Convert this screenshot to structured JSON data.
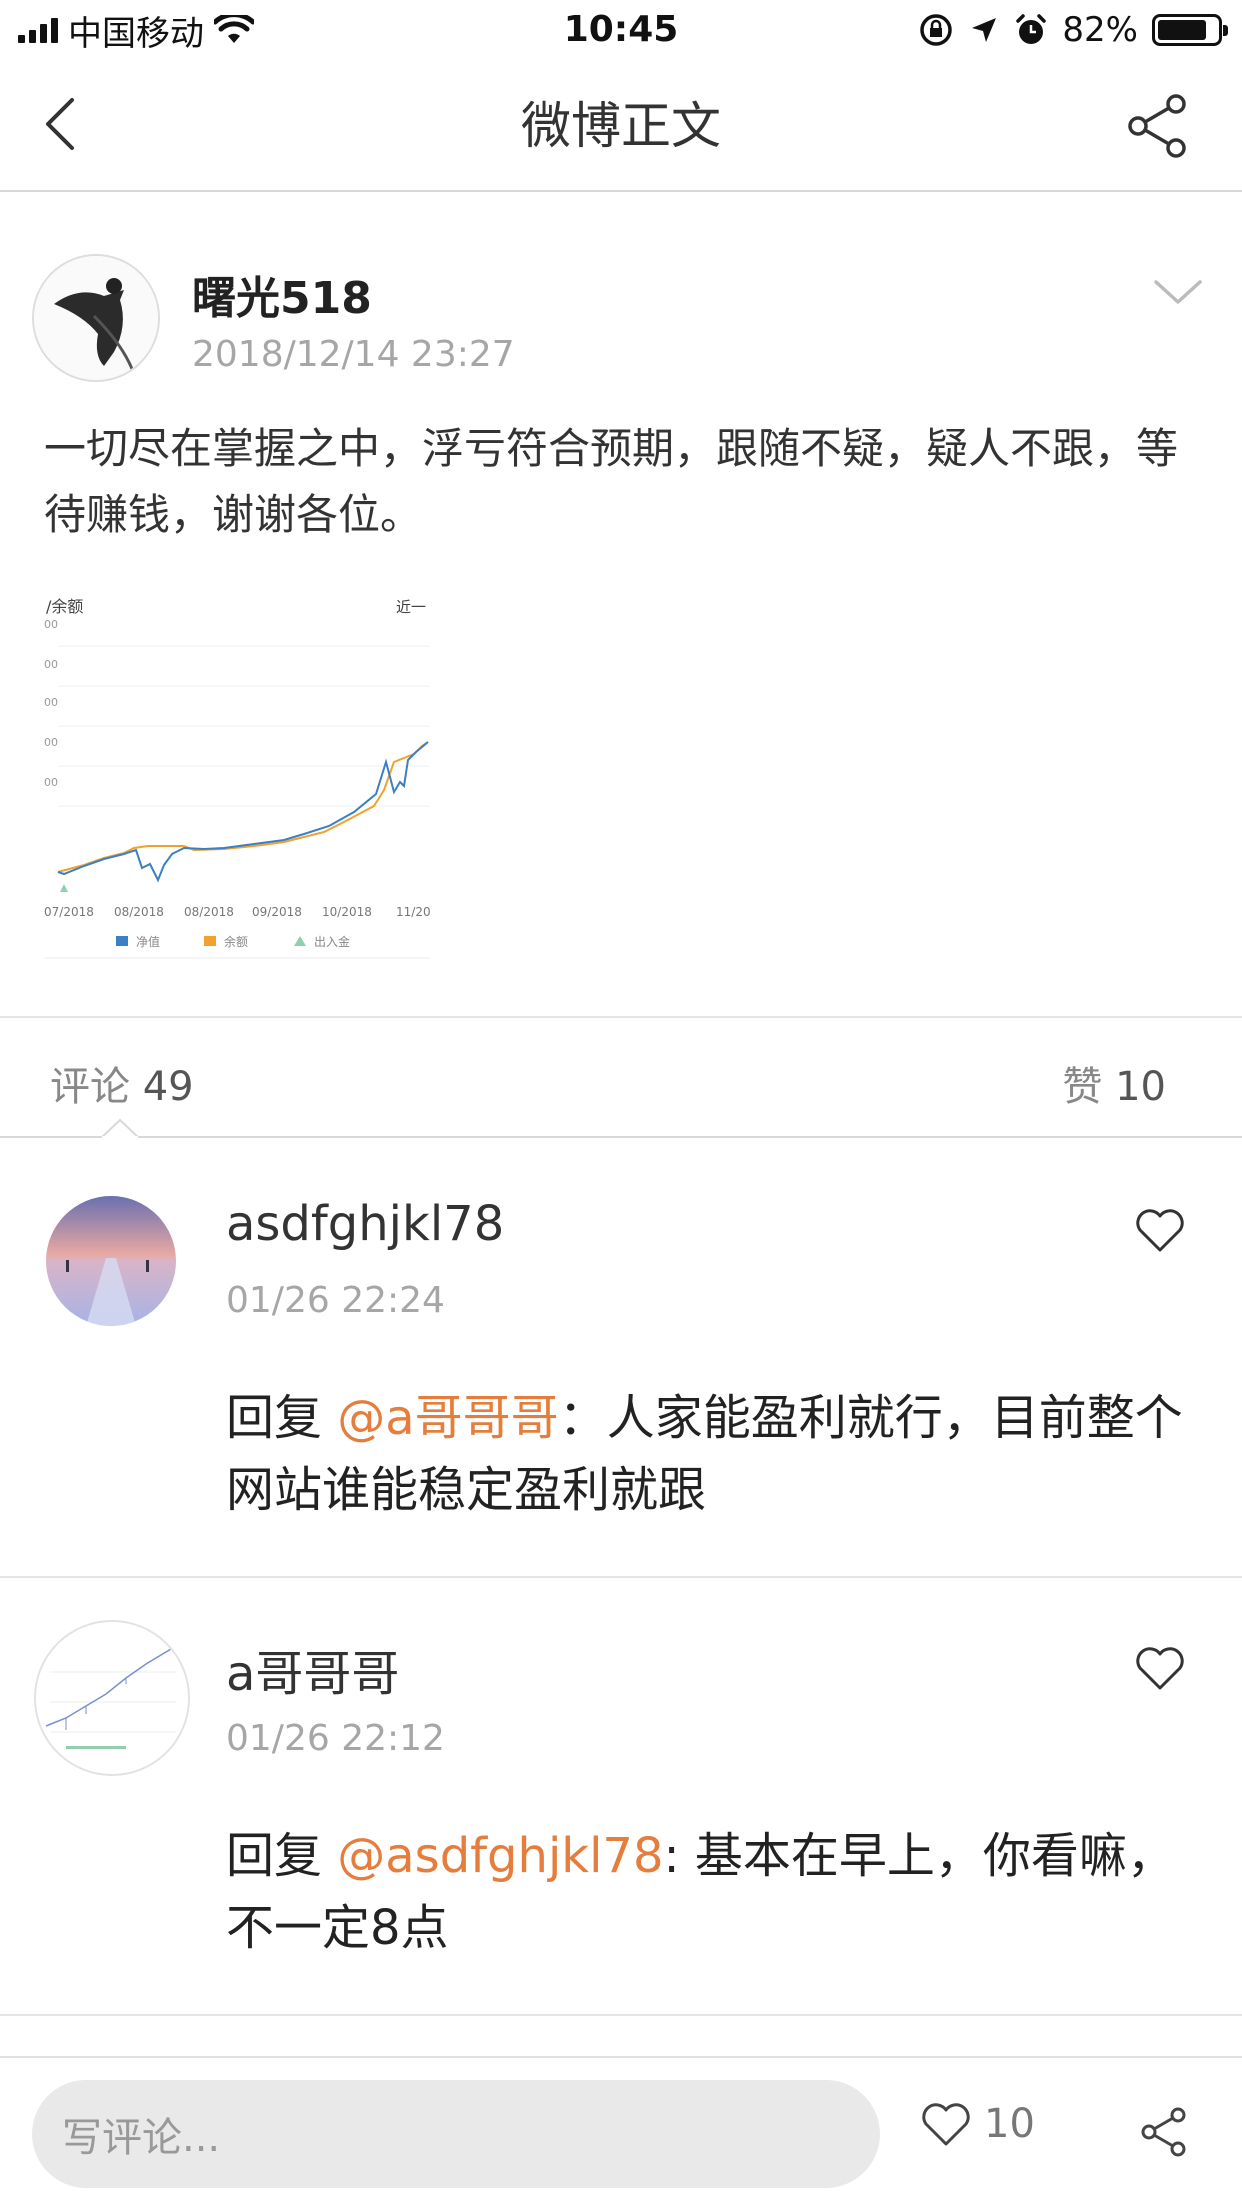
{
  "status_bar": {
    "carrier": "中国移动",
    "time": "10:45",
    "battery": "82%",
    "battery_level": 0.82
  },
  "nav": {
    "title": "微博正文"
  },
  "post": {
    "author": "曙光518",
    "time": "2018/12/14 23:27",
    "text": "一切尽在掌握之中，浮亏符合预期，跟随不疑，疑人不跟，等待赚钱，谢谢各位。"
  },
  "chart_data": {
    "type": "line",
    "title": "/余额",
    "corner_label": "近一",
    "ytick_labels": [
      "00",
      "00",
      "00",
      "00",
      "00"
    ],
    "x": [
      "07/2018",
      "08/2018",
      "08/2018",
      "09/2018",
      "10/2018",
      "11/20"
    ],
    "series": [
      {
        "name": "净值",
        "color": "#3b7fc4"
      },
      {
        "name": "余额",
        "color": "#f0a12e"
      },
      {
        "name": "出入金",
        "color": "#8fd0b0"
      }
    ]
  },
  "tabs": {
    "comments_label": "评论",
    "comments_count": "49",
    "likes_label": "赞",
    "likes_count": "10"
  },
  "comments": [
    {
      "name": "asdfghjkl78",
      "time": "01/26 22:24",
      "reply_prefix": "回复 ",
      "mention": "@a哥哥哥",
      "text": "：人家能盈利就行，目前整个网站谁能稳定盈利就跟"
    },
    {
      "name": "a哥哥哥",
      "time": "01/26 22:12",
      "reply_prefix": "回复 ",
      "mention": "@asdfghjkl78",
      "text": ": 基本在早上，你看嘛，不一定8点"
    }
  ],
  "bottom_bar": {
    "input_placeholder": "写评论...",
    "like_count": "10"
  },
  "colors": {
    "mention": "#e57d3c",
    "muted": "#a6a6a6"
  }
}
